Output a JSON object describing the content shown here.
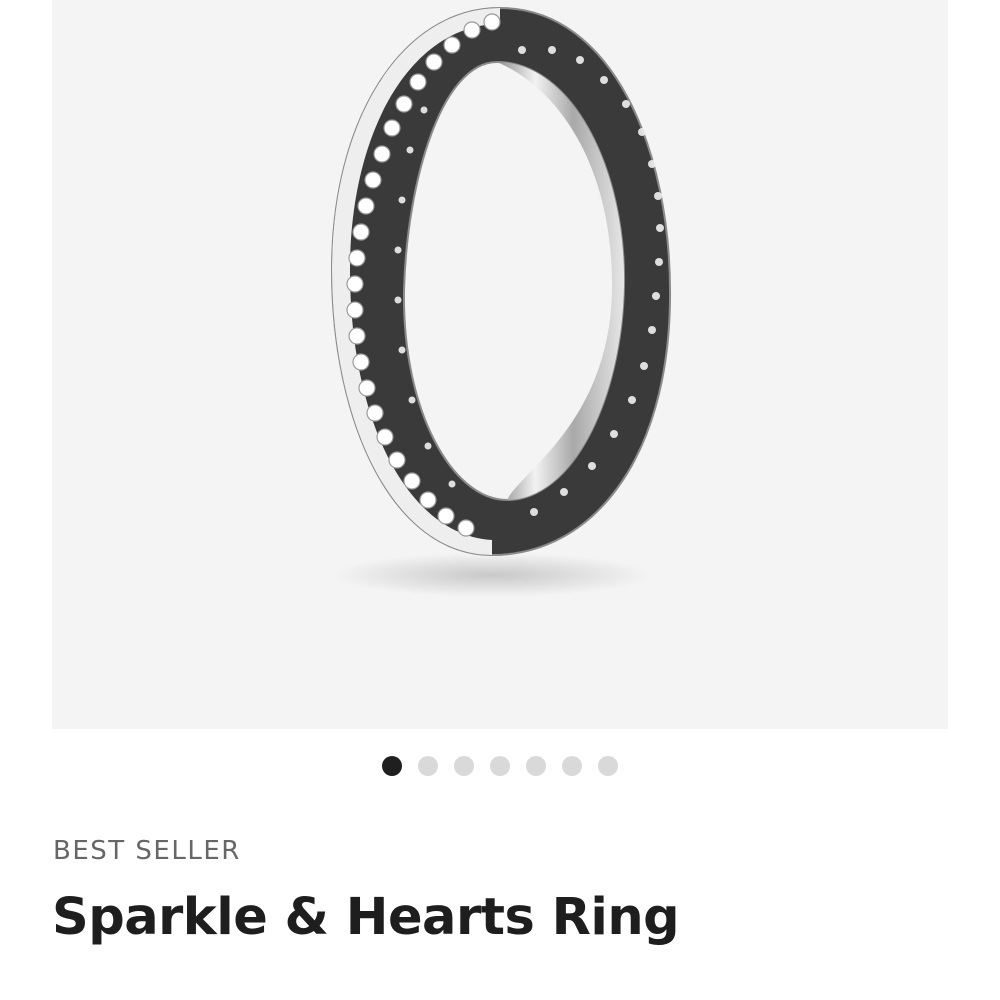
{
  "product": {
    "badge": "BEST SELLER",
    "title": "Sparkle & Hearts Ring",
    "image_label": "Sparkle & Hearts Ring"
  },
  "gallery": {
    "total_images": 7,
    "active_index": 0,
    "next_icon": "chevron-right-icon"
  },
  "colors": {
    "gallery_bg": "#f4f4f4",
    "dot_active": "#1f1f1f",
    "dot_inactive": "#d9d9d9",
    "badge_text": "#666666",
    "title_text": "#1e1e1e"
  }
}
